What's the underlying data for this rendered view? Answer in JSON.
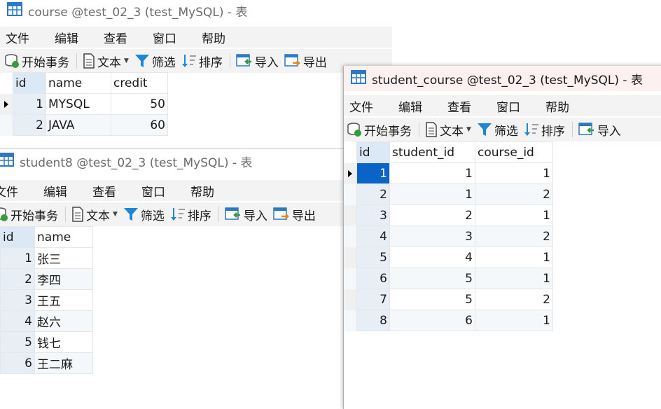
{
  "course_window": {
    "title": "course @test_02_3 (test_MySQL) - 表",
    "menu": [
      "文件",
      "编辑",
      "查看",
      "窗口",
      "帮助"
    ],
    "toolbar": {
      "begin_tx": "开始事务",
      "text": "文本",
      "filter": "筛选",
      "sort": "排序",
      "import": "导入",
      "export": "导出"
    },
    "columns": [
      "id",
      "name",
      "credit"
    ],
    "rows": [
      [
        "1",
        "MYSQL",
        "50"
      ],
      [
        "2",
        "JAVA",
        "60"
      ]
    ]
  },
  "student_window": {
    "title": "student8 @test_02_3 (test_MySQL) - 表",
    "menu": [
      "文件",
      "编辑",
      "查看",
      "窗口",
      "帮助"
    ],
    "toolbar": {
      "begin_tx": "开始事务",
      "text": "文本",
      "filter": "筛选",
      "sort": "排序",
      "import": "导入",
      "export": "导出"
    },
    "columns": [
      "id",
      "name"
    ],
    "rows": [
      [
        "1",
        "张三"
      ],
      [
        "2",
        "李四"
      ],
      [
        "3",
        "王五"
      ],
      [
        "4",
        "赵六"
      ],
      [
        "5",
        "钱七"
      ],
      [
        "6",
        "王二麻"
      ]
    ]
  },
  "sc_window": {
    "title": "student_course @test_02_3 (test_MySQL) - 表",
    "menu": [
      "文件",
      "编辑",
      "查看",
      "窗口",
      "帮助"
    ],
    "toolbar": {
      "begin_tx": "开始事务",
      "text": "文本",
      "filter": "筛选",
      "sort": "排序",
      "import": "导入"
    },
    "columns": [
      "id",
      "student_id",
      "course_id"
    ],
    "rows": [
      [
        "1",
        "1",
        "1"
      ],
      [
        "2",
        "1",
        "2"
      ],
      [
        "3",
        "2",
        "1"
      ],
      [
        "4",
        "3",
        "2"
      ],
      [
        "5",
        "4",
        "1"
      ],
      [
        "6",
        "5",
        "1"
      ],
      [
        "7",
        "5",
        "2"
      ],
      [
        "8",
        "6",
        "1"
      ]
    ]
  },
  "colors": {
    "selection": "#0a64c8",
    "table_icon": "#2b78c5",
    "filter_icon": "#1f86d6",
    "import_icon_arrow": "#3a9a3a",
    "export_icon_arrow": "#e08a1e"
  },
  "icons": [
    "table-icon",
    "database-transaction-icon",
    "text-document-icon",
    "filter-icon",
    "sort-icon",
    "import-icon",
    "export-icon",
    "row-pointer-icon"
  ]
}
